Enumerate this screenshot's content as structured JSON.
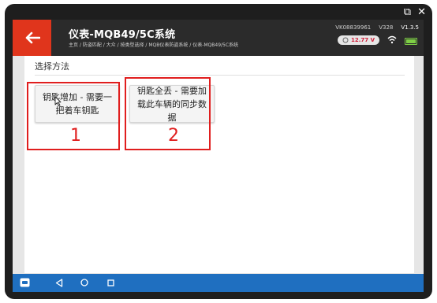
{
  "window": {
    "controls": [
      "⧉",
      "✕"
    ]
  },
  "header": {
    "title": "仪表-MQB49/5C系统",
    "breadcrumb": "主页 / 防盗匹配 / 大众 / 按类型选择 / MQB仪表防盗系统 / 仪表-MQB49/5C系统",
    "serial": "VK08839961",
    "version_code": "V328",
    "app_version": "V1.3.5",
    "voltage": "12.77 V"
  },
  "main": {
    "section_title": "选择方法",
    "options": [
      {
        "label": "钥匙增加 - 需要一把着车钥匙"
      },
      {
        "label": "钥匙全丢 - 需要加载此车辆的同步数据"
      }
    ]
  },
  "annotations": {
    "labels": [
      "1",
      "2"
    ],
    "color": "#e01e1e"
  },
  "colors": {
    "accent": "#e0351c",
    "navbar": "#1f6fc0",
    "battery": "#7ecf45"
  },
  "icons": {
    "back": "back-arrow-icon",
    "wifi": "wifi-icon",
    "battery": "battery-icon",
    "home": "home-icon",
    "nav_back": "nav-back-icon",
    "recents": "recents-icon",
    "app": "app-switch-icon"
  }
}
